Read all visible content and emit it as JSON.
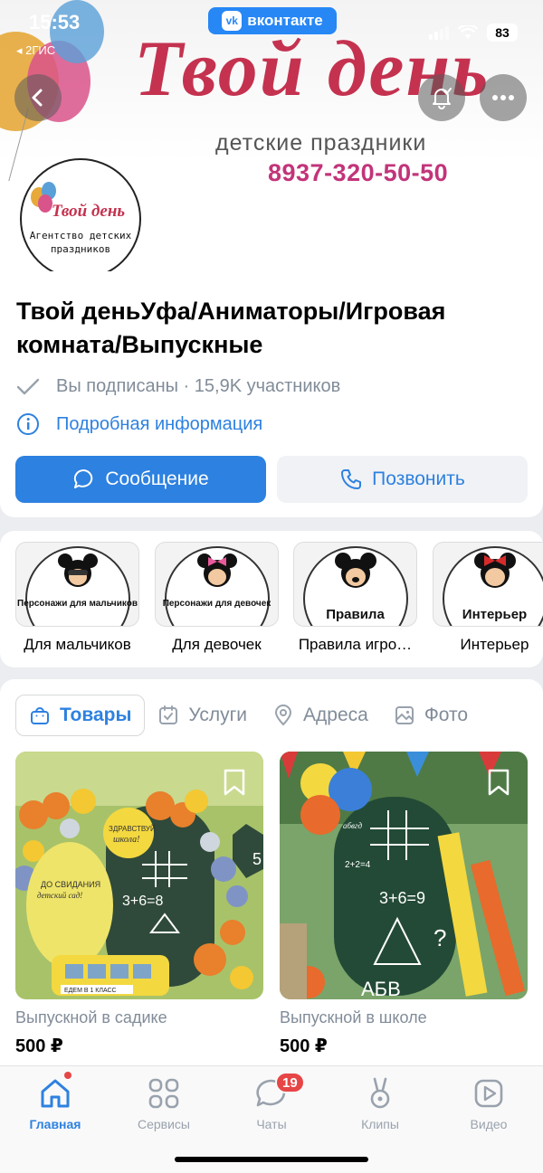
{
  "status_bar": {
    "time": "15:53",
    "back_app": "◂ 2ГИС",
    "app_name": "вконтакте",
    "vk_logo": "vk",
    "battery": "83"
  },
  "cover": {
    "title": "Твой день",
    "subtitle": "детские праздники",
    "phone": "8937-320-50-50"
  },
  "avatar": {
    "title": "Твой день",
    "subtitle_line1": "Агентство детских",
    "subtitle_line2": "праздников"
  },
  "group": {
    "name": "Твой деньУфа/Аниматоры/Игровая комната/Выпускные",
    "subscribed": "Вы подписаны · 15,9K участников",
    "details_link": "Подробная информация",
    "message_button": "Сообщение",
    "call_button": "Позвонить"
  },
  "stories": [
    {
      "caption": "Персонажи для мальчиков",
      "label": "Для мальчиков"
    },
    {
      "caption": "Персонажи для девочек",
      "label": "Для девочек"
    },
    {
      "caption": "Правила",
      "label": "Правила игро…"
    },
    {
      "caption": "Интерьер",
      "label": "Интерьер"
    }
  ],
  "tabs": [
    {
      "label": "Товары",
      "icon": "bag-icon"
    },
    {
      "label": "Услуги",
      "icon": "calendar-icon"
    },
    {
      "label": "Адреса",
      "icon": "location-icon"
    },
    {
      "label": "Фото",
      "icon": "photo-icon"
    }
  ],
  "products": [
    {
      "title": "Выпускной в садике",
      "price": "500 ₽",
      "image_text": {
        "sign_left": "ДО СВИДАНИЯ детский сад!",
        "sign_circle": "ЗДРАВСТВУЙ школа!",
        "board": "3+6=8",
        "bus_sign": "ЕДЕМ В 1 КЛАСС",
        "hex": "5"
      }
    },
    {
      "title": "Выпускной в школе",
      "price": "500 ₽",
      "image_text": {
        "board_top": "абвгд",
        "board_formula": "3+6=9",
        "board_left": "2+2=4",
        "board_bottom": "АБВ"
      }
    }
  ],
  "tabbar": {
    "home": "Главная",
    "services": "Сервисы",
    "chats": "Чаты",
    "chats_badge": "19",
    "clips": "Клипы",
    "video": "Видео"
  },
  "colors": {
    "accent": "#2d81e0",
    "cover_title": "#c4324f",
    "phone": "#c2347a",
    "badge": "#e64646"
  }
}
